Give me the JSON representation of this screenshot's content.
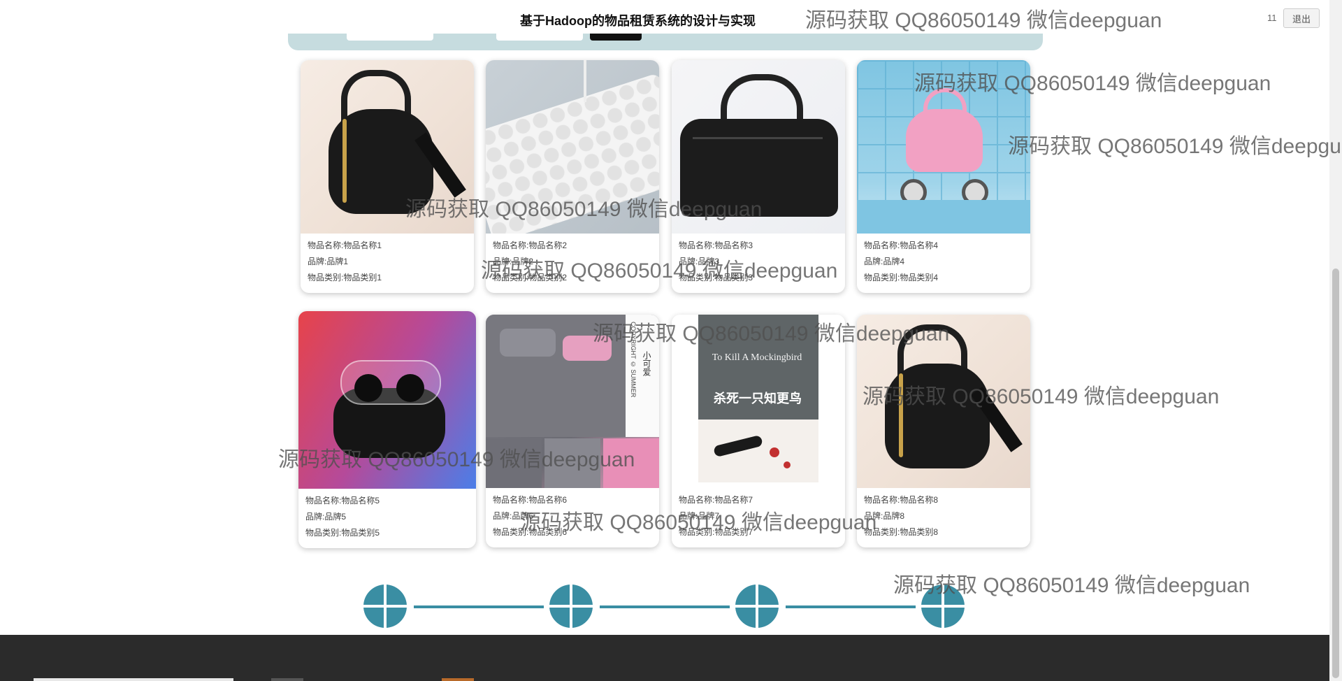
{
  "header": {
    "title": "基于Hadoop的物品租赁系统的设计与实现",
    "user_count": "11",
    "logout_label": "退出"
  },
  "items": [
    {
      "name": "物品名称:物品名称1",
      "brand": "品牌:品牌1",
      "category": "物品类别:物品类别1",
      "image": "black-backpack"
    },
    {
      "name": "物品名称:物品名称2",
      "brand": "品牌:品牌2",
      "category": "物品类别:物品类别2",
      "image": "white-keyboard"
    },
    {
      "name": "物品名称:物品名称3",
      "brand": "品牌:品牌3",
      "category": "物品类别:物品类别3",
      "image": "black-handbag"
    },
    {
      "name": "物品名称:物品名称4",
      "brand": "品牌:品牌4",
      "category": "物品类别:物品类别4",
      "image": "pink-stroller"
    },
    {
      "name": "物品名称:物品名称5",
      "brand": "品牌:品牌5",
      "category": "物品类别:物品类别5",
      "image": "wireless-earbuds"
    },
    {
      "name": "物品名称:物品名称6",
      "brand": "品牌:品牌6",
      "category": "物品类别:物品类别6",
      "image": "bedding-set"
    },
    {
      "name": "物品名称:物品名称7",
      "brand": "品牌:品牌7",
      "category": "物品类别:物品类别7",
      "image": "book"
    },
    {
      "name": "物品名称:物品名称8",
      "brand": "品牌:品牌8",
      "category": "物品类别:物品类别8",
      "image": "black-backpack"
    }
  ],
  "book_cover": {
    "title_en": "To Kill A Mockingbird",
    "title_cn": "杀死一只知更鸟"
  },
  "bedding_text": {
    "caption": "小可爱",
    "copyright": "COPYRIGHT © SUMMER"
  },
  "watermark": "源码获取 QQ86050149 微信deepguan",
  "colors": {
    "accent": "#3a8ea3",
    "search_strip": "#c6dcdf",
    "footer": "#2b2b2b"
  }
}
